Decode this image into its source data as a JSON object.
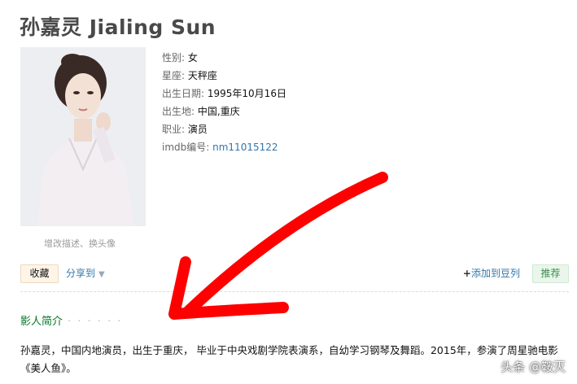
{
  "page": {
    "title": "孙嘉灵 Jialing Sun"
  },
  "photo": {
    "edit_link": "增改描述、换头像"
  },
  "info": {
    "rows": [
      {
        "label": "性别",
        "value": "女"
      },
      {
        "label": "星座",
        "value": "天秤座"
      },
      {
        "label": "出生日期",
        "value": "1995年10月16日"
      },
      {
        "label": "出生地",
        "value": "中国,重庆"
      },
      {
        "label": "职业",
        "value": "演员"
      },
      {
        "label": "imdb编号",
        "value": "nm11015122"
      }
    ]
  },
  "actions": {
    "collect_label": "收藏",
    "share_label": "分享到",
    "add_doulist_plus": "+",
    "add_doulist_label": "添加到豆列",
    "recommend_label": "推荐"
  },
  "bio": {
    "section_title": "影人简介",
    "section_dots": "· · · · · ·",
    "text": "孙嘉灵，中国内地演员，出生于重庆， 毕业于中央戏剧学院表演系，自幼学习钢琴及舞蹈。2015年，参演了周星驰电影《美人鱼》。"
  },
  "overlay": {
    "watermark": "头条 @鞍灭",
    "arrow_color": "#ff0000",
    "arrow_icon": "red-arrow-icon"
  }
}
